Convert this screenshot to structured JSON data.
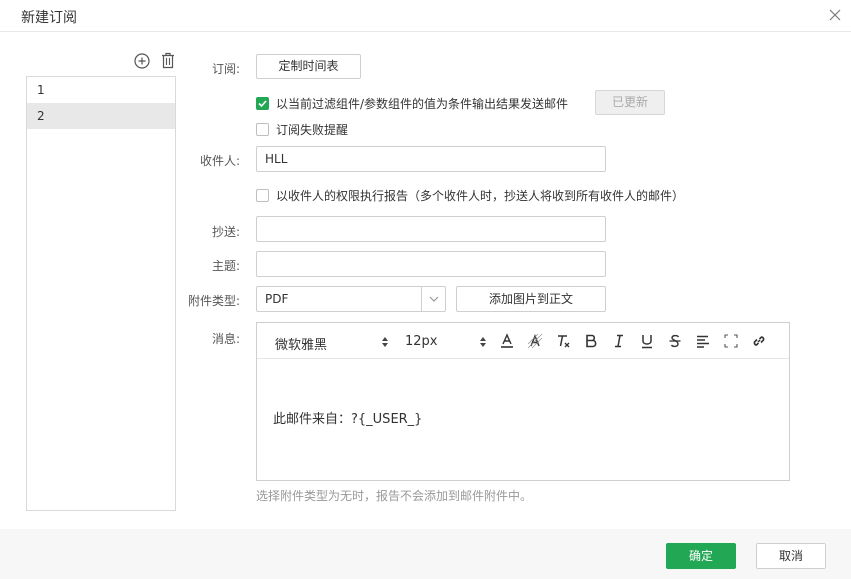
{
  "dialog": {
    "title": "新建订阅",
    "close_icon": "close-icon"
  },
  "subscriptions": {
    "add_icon": "plus-circle-icon",
    "delete_icon": "trash-icon",
    "items": [
      {
        "label": "1",
        "selected": false
      },
      {
        "label": "2",
        "selected": true
      }
    ]
  },
  "form": {
    "subscribe_label": "订阅:",
    "schedule_button": "定制时间表",
    "filter_checkbox": {
      "label": "以当前过滤组件/参数组件的值为条件输出结果发送邮件",
      "checked": true
    },
    "updated_button": "已更新",
    "fail_alert_checkbox": {
      "label": "订阅失败提醒",
      "checked": false
    },
    "recipient_label": "收件人:",
    "recipient_value": "HLL",
    "permission_checkbox": {
      "label": "以收件人的权限执行报告（多个收件人时，抄送人将收到所有收件人的邮件）",
      "checked": false
    },
    "cc_label": "抄送:",
    "cc_value": "",
    "subject_label": "主题:",
    "subject_value": "",
    "attachment_label": "附件类型:",
    "attachment_value": "PDF",
    "add_image_button": "添加图片到正文",
    "message_label": "消息:",
    "editor": {
      "font_family": "微软雅黑",
      "font_size": "12px",
      "body": "此邮件来自：?{_USER_}"
    },
    "hint": "选择附件类型为无时，报告不会添加到邮件附件中。"
  },
  "footer": {
    "ok_button": "确定",
    "cancel_button": "取消"
  },
  "colors": {
    "accent": "#22a755",
    "border": "#cfcfcf"
  }
}
